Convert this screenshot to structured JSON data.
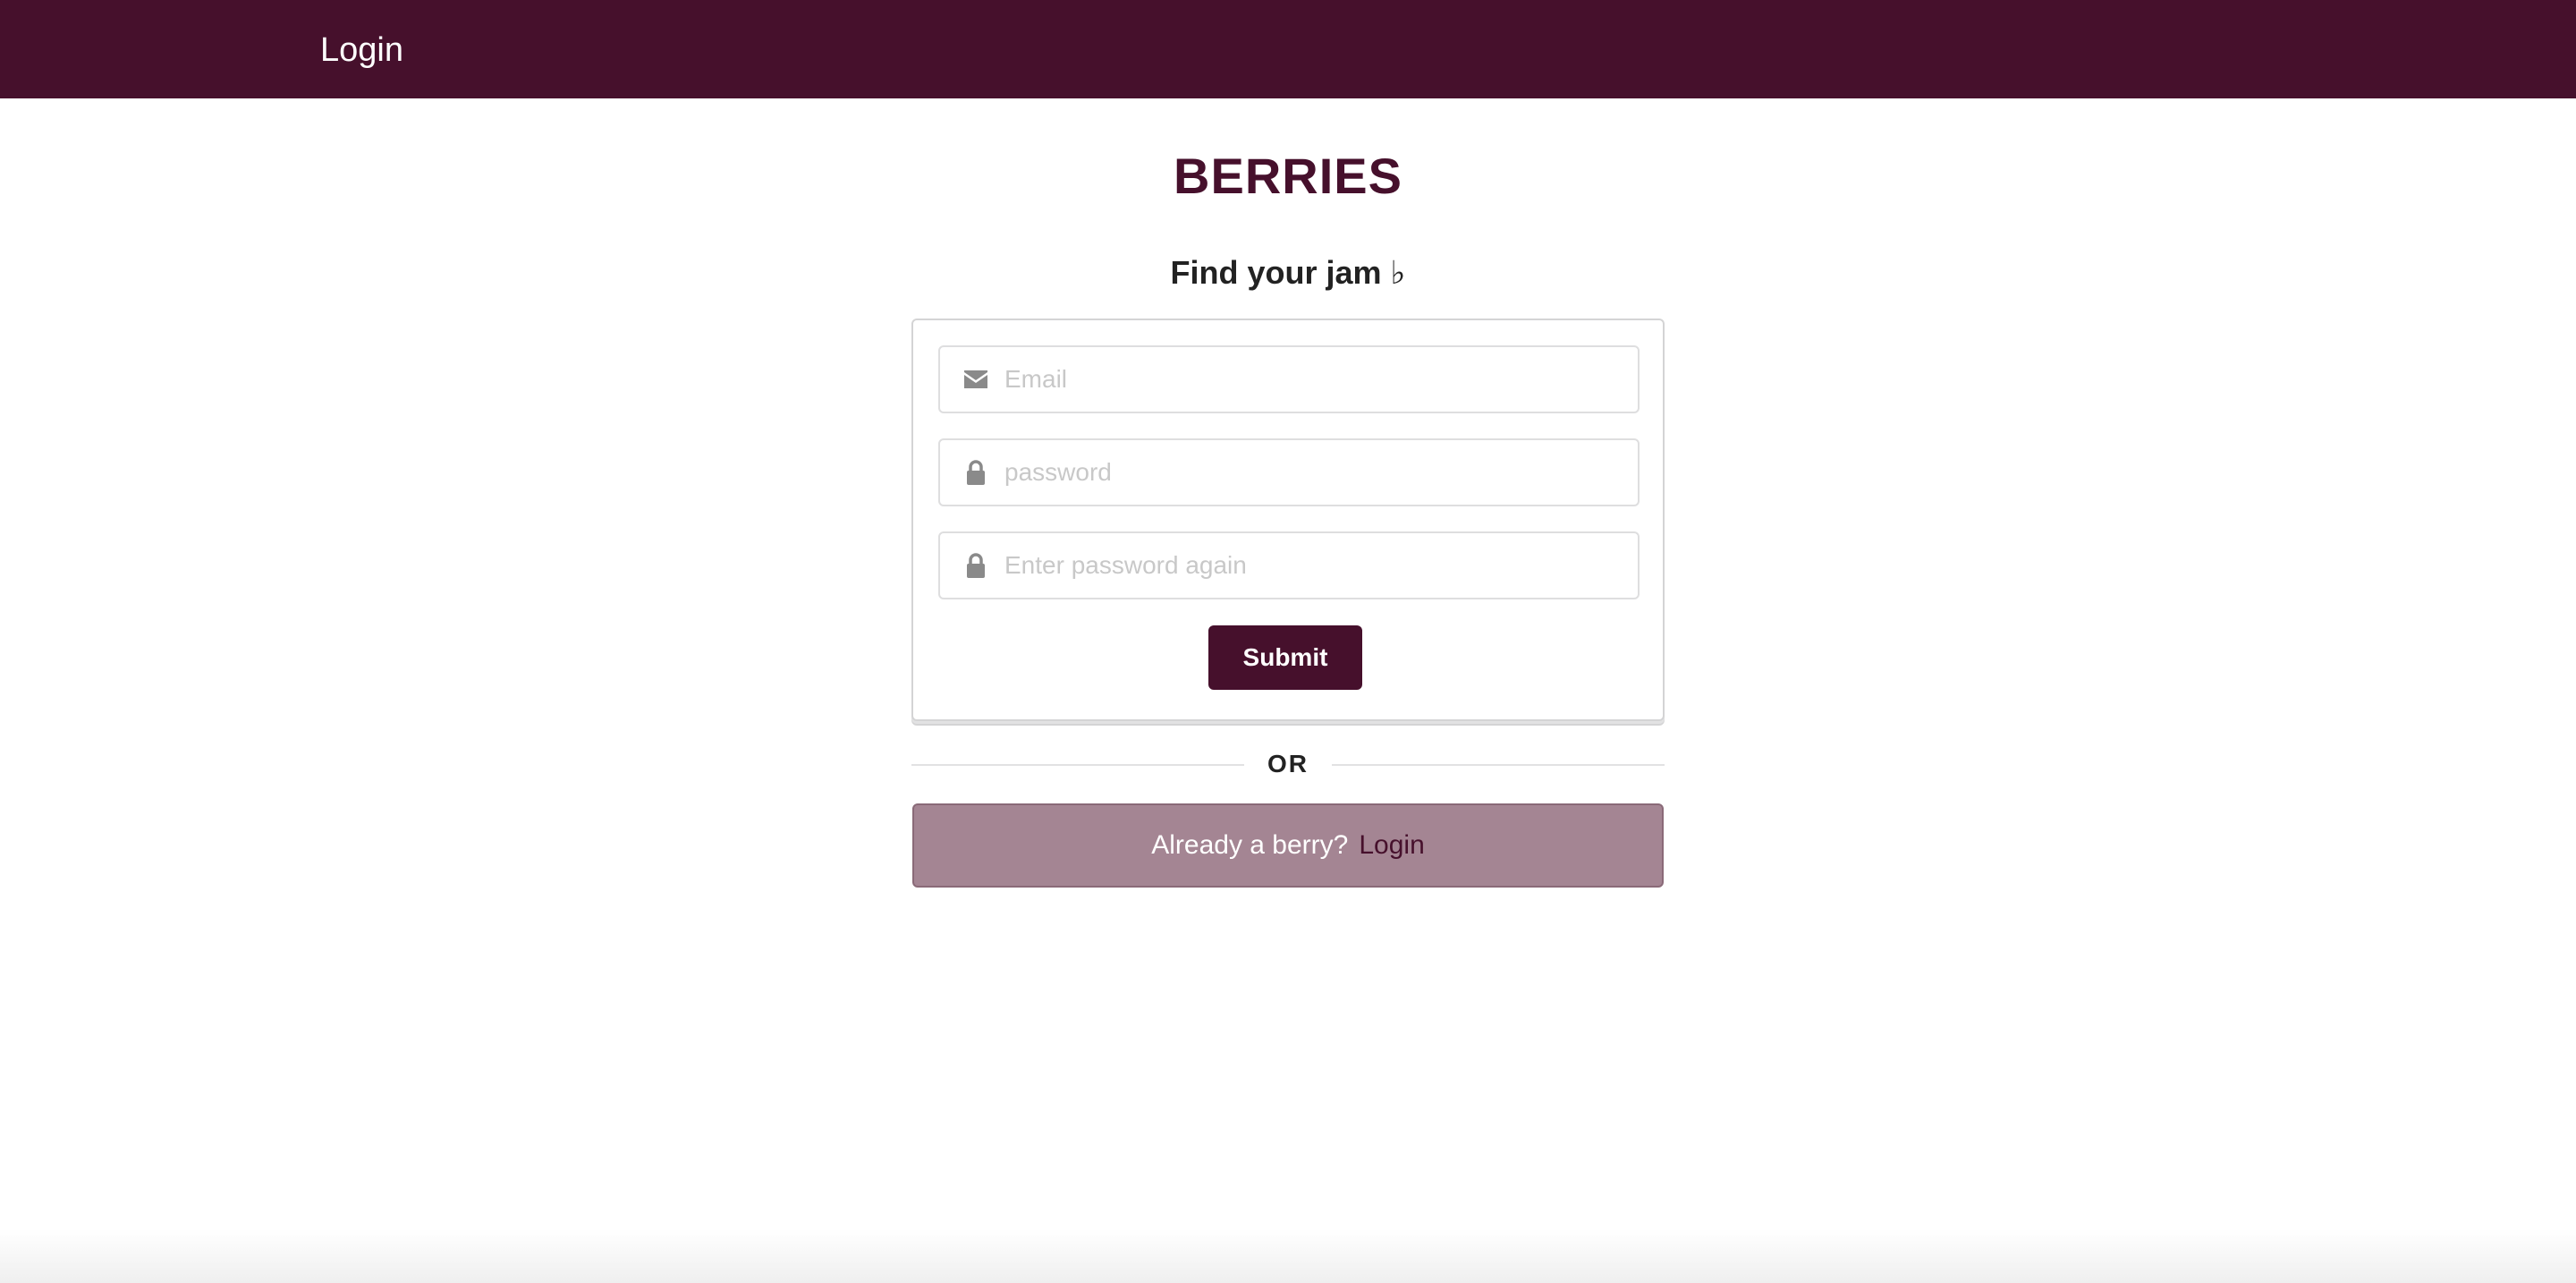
{
  "navbar": {
    "login_link": "Login",
    "background_color": "#46102c"
  },
  "brand": {
    "title": "BERRIES",
    "color": "#46102c"
  },
  "tagline": "Find your jam ♭",
  "form": {
    "email": {
      "placeholder": "Email",
      "value": "",
      "icon": "envelope-icon"
    },
    "password": {
      "placeholder": "password",
      "value": "",
      "icon": "lock-icon"
    },
    "password_confirm": {
      "placeholder": "Enter password again",
      "value": "",
      "icon": "lock-icon"
    },
    "submit_label": "Submit"
  },
  "divider": {
    "label": "OR"
  },
  "login_prompt": {
    "text": "Already a berry?",
    "link_label": "Login",
    "background_color": "#a48593"
  }
}
